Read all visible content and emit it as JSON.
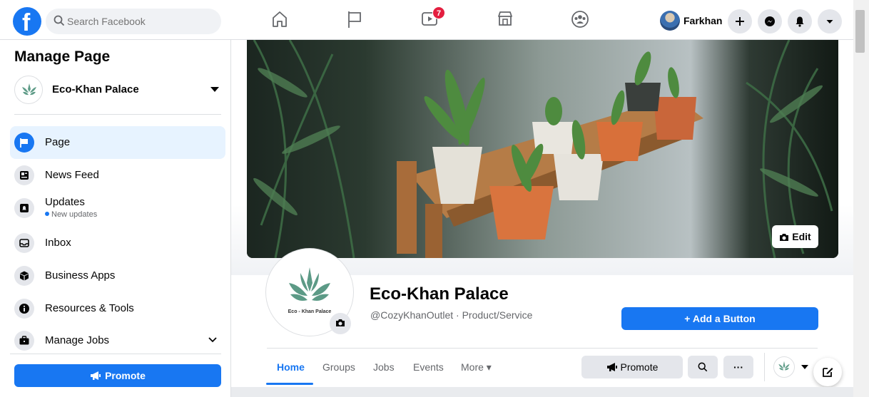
{
  "topbar": {
    "logo": "f",
    "search_placeholder": "Search Facebook",
    "nav_icons": [
      "home-icon",
      "flag-icon",
      "watch-icon",
      "marketplace-icon",
      "groups-icon"
    ],
    "watch_badge": "7",
    "profile_name": "Farkhan",
    "action_icons": [
      "plus-icon",
      "messenger-icon",
      "bell-icon",
      "caret-down-icon"
    ]
  },
  "sidebar": {
    "title": "Manage Page",
    "page_name": "Eco-Khan Palace",
    "items": [
      {
        "label": "Page",
        "icon": "flag-icon",
        "active": true
      },
      {
        "label": "News Feed",
        "icon": "newsfeed-icon"
      },
      {
        "label": "Updates",
        "sub": "New updates",
        "icon": "updates-icon"
      },
      {
        "label": "Inbox",
        "icon": "inbox-icon"
      },
      {
        "label": "Business Apps",
        "icon": "cube-icon"
      },
      {
        "label": "Resources & Tools",
        "icon": "info-icon"
      },
      {
        "label": "Manage Jobs",
        "icon": "briefcase-icon"
      }
    ],
    "promote_label": "Promote"
  },
  "cover": {
    "edit_label": "Edit"
  },
  "page": {
    "logo_text": "Eco - Khan Palace",
    "name": "Eco-Khan Palace",
    "subtitle": "@CozyKhanOutlet · Product/Service",
    "add_button_label": "+ Add a Button"
  },
  "tabs": [
    {
      "label": "Home",
      "active": true
    },
    {
      "label": "Groups"
    },
    {
      "label": "Jobs"
    },
    {
      "label": "Events"
    },
    {
      "label": "More ▾"
    }
  ],
  "actions": {
    "promote_label": "Promote",
    "more_label": "···"
  },
  "colors": {
    "brand": "#1877f2",
    "badge": "#e41e3f"
  }
}
